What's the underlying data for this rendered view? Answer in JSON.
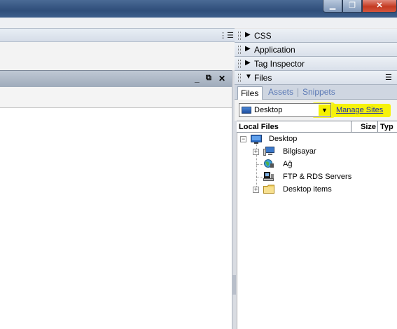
{
  "window": {
    "minimize_glyph": "▁",
    "maximize_glyph": "❐",
    "close_glyph": "✕"
  },
  "icons": {
    "panel_menu": "options-menu-icon",
    "doc_minimize": "minimize-icon",
    "doc_restore": "restore-icon",
    "doc_close": "close-icon",
    "expand": "plus-icon",
    "collapse": "minus-icon",
    "computer": "computer-icon",
    "network": "network-icon",
    "server": "server-icon",
    "folder": "folder-icon",
    "desktop": "desktop-icon"
  },
  "document": {
    "minimize_glyph": "_",
    "restore_glyph": "⧉",
    "close_glyph": "✕"
  },
  "panels": {
    "css": {
      "title": "CSS",
      "expanded": false
    },
    "application": {
      "title": "Application",
      "expanded": false
    },
    "tag_inspector": {
      "title": "Tag Inspector",
      "expanded": false
    },
    "files": {
      "title": "Files",
      "expanded": true
    }
  },
  "files_panel": {
    "tabs": [
      {
        "label": "Files",
        "active": true
      },
      {
        "label": "Assets",
        "active": false
      },
      {
        "label": "Snippets",
        "active": false
      }
    ],
    "site_select": {
      "value": "Desktop"
    },
    "manage_sites": "Manage Sites",
    "columns": {
      "local": "Local Files",
      "size": "Size",
      "type": "Typ"
    },
    "tree": {
      "root": {
        "label": "Desktop",
        "state": "collapse"
      },
      "children": [
        {
          "label": "Bilgisayar",
          "expandable": true
        },
        {
          "label": "Ağ",
          "expandable": false
        },
        {
          "label": "FTP & RDS Servers",
          "expandable": false
        },
        {
          "label": "Desktop items",
          "expandable": true
        }
      ]
    }
  },
  "colors": {
    "highlight": "#f6f20a",
    "link": "#2032a8",
    "inactive_tab": "#5b79b5"
  }
}
